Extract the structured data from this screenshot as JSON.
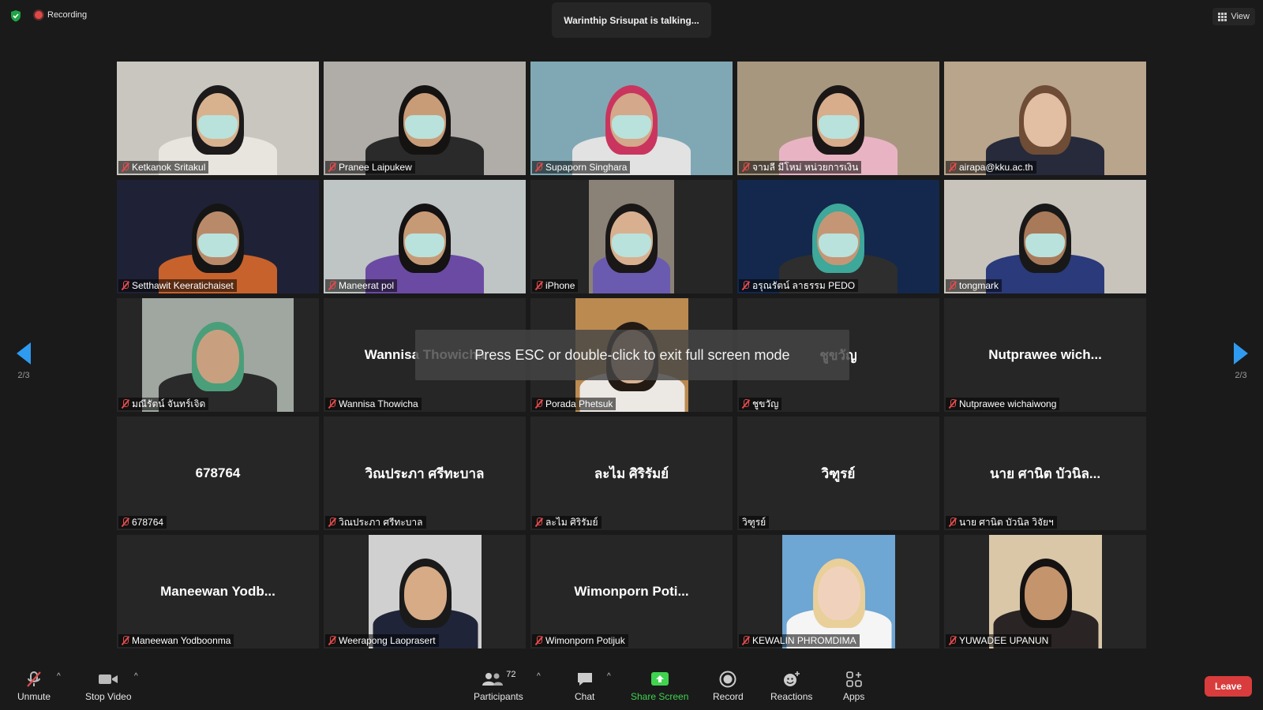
{
  "topbar": {
    "recording_label": "Recording",
    "talking_label": "Warinthip Srisupat is talking...",
    "view_label": "View"
  },
  "overlay": {
    "message": "Press ESC or double-click to exit full screen mode"
  },
  "pager": {
    "left_label": "2/3",
    "right_label": "2/3"
  },
  "tiles": [
    {
      "name": "Ketkanok Sritakul",
      "muted": true,
      "video": true
    },
    {
      "name": "Pranee Laipukew",
      "muted": true,
      "video": true
    },
    {
      "name": "Supaporn Singhara",
      "muted": true,
      "video": true
    },
    {
      "name": "จามลี มีโหม่ หน่วยการเงิน",
      "muted": true,
      "video": true
    },
    {
      "name": "airapa@kku.ac.th",
      "muted": true,
      "video": true
    },
    {
      "name": "Setthawit Keeratichaiset",
      "muted": true,
      "video": true
    },
    {
      "name": "Maneerat pol",
      "muted": true,
      "video": true
    },
    {
      "name": "iPhone",
      "muted": true,
      "video": true
    },
    {
      "name": "อรุณรัตน์ ลาธรรม PEDO",
      "muted": true,
      "video": true
    },
    {
      "name": "tongmark",
      "muted": true,
      "video": true
    },
    {
      "name": "มณีรัตน์ จันทร์เจิด",
      "muted": true,
      "video": true
    },
    {
      "name": "Wannisa Thowicha",
      "muted": true,
      "video": false,
      "display_name": "Wannisa Thowicha"
    },
    {
      "name": "Porada Phetsuk",
      "muted": true,
      "video": true
    },
    {
      "name": "ชูขวัญ",
      "muted": true,
      "video": false,
      "display_name": "ชูขวัญ"
    },
    {
      "name": "Nutprawee wichaiwong",
      "muted": true,
      "video": false,
      "display_name": "Nutprawee wich..."
    },
    {
      "name": "678764",
      "muted": true,
      "video": false,
      "display_name": "678764"
    },
    {
      "name": "วิณประภา ศรีทะบาล",
      "muted": true,
      "video": false,
      "display_name": "วิณประภา ศรีทะบาล"
    },
    {
      "name": "ละไม ศิริรัมย์",
      "muted": true,
      "video": false,
      "display_name": "ละไม ศิริรัมย์"
    },
    {
      "name": "วิฑูรย์",
      "muted": false,
      "video": false,
      "display_name": "วิฑูรย์"
    },
    {
      "name": "นาย ศานิต บัวนิล วิจัยฯ",
      "muted": true,
      "video": false,
      "display_name": "นาย ศานิต บัวนิล..."
    },
    {
      "name": "Maneewan Yodboonma",
      "muted": true,
      "video": false,
      "display_name": "Maneewan Yodb..."
    },
    {
      "name": "Weerapong Laoprasert",
      "muted": true,
      "video": true
    },
    {
      "name": "Wimonporn Potijuk",
      "muted": true,
      "video": false,
      "display_name": "Wimonporn Poti..."
    },
    {
      "name": "KEWALIN PHROMDIMA",
      "muted": true,
      "video": true
    },
    {
      "name": "YUWADEE UPANUN",
      "muted": true,
      "video": true
    }
  ],
  "toolbar": {
    "unmute_label": "Unmute",
    "stop_video_label": "Stop Video",
    "participants_label": "Participants",
    "participants_count": "72",
    "chat_label": "Chat",
    "share_label": "Share Screen",
    "record_label": "Record",
    "reactions_label": "Reactions",
    "apps_label": "Apps",
    "leave_label": "Leave"
  },
  "colors": {
    "accent_blue": "#2e9bf0",
    "share_green": "#3fd34f",
    "leave_red": "#d93c3c",
    "muted_red": "#e24b4b"
  }
}
